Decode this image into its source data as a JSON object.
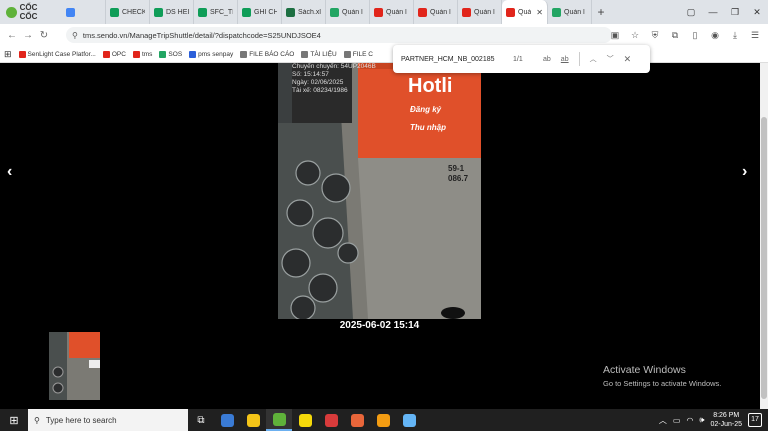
{
  "browser": {
    "brand": "CỐC CỐC",
    "tabs": [
      {
        "label": "",
        "color": "#4285f4"
      },
      {
        "label": "CHECK",
        "color": "#0f9d58"
      },
      {
        "label": "DS HEI",
        "color": "#0f9d58"
      },
      {
        "label": "SFC_TI",
        "color": "#0f9d58"
      },
      {
        "label": "GHI CH",
        "color": "#0f9d58"
      },
      {
        "label": "Sách.xl",
        "color": "#1d6f42"
      },
      {
        "label": "Quản l",
        "color": "#22a563"
      },
      {
        "label": "Quản l",
        "color": "#e1251b"
      },
      {
        "label": "Quản l",
        "color": "#e1251b"
      },
      {
        "label": "Quản l",
        "color": "#e1251b"
      },
      {
        "label": "Quả",
        "color": "#e1251b",
        "active": true
      },
      {
        "label": "Quản l",
        "color": "#22a563"
      }
    ],
    "url": "tms.sendo.vn/ManageTripShuttle/detail/?dispatchcode=S25UNDJSOE4",
    "bookmarks": [
      {
        "label": "SenLight Case Platfor...",
        "color": "#e1251b"
      },
      {
        "label": "OPC",
        "color": "#e1251b"
      },
      {
        "label": "tms",
        "color": "#e1251b"
      },
      {
        "label": "SOS",
        "color": "#22a563"
      },
      {
        "label": "pms senpay",
        "color": "#2b5fd9"
      },
      {
        "label": "FILE BÁO CÁO",
        "color": "#777"
      },
      {
        "label": "TÀI LIỆU",
        "color": "#777"
      },
      {
        "label": "FILE C",
        "color": "#777"
      }
    ]
  },
  "find": {
    "query": "PARTNER_HCM_NB_002185",
    "count": "1/1",
    "match_case": "ab",
    "whole_word": "ab"
  },
  "viewer": {
    "overlay_lines": [
      "Chuyến chuyến: 54UP2046B",
      "Số: 15:14:57",
      "Ngày: 02/06/2025",
      "Tài xế: 08234/1986"
    ],
    "sign_text": "Hotli",
    "sign_line1": "Đăng ký",
    "sign_line2": "Thu nhập",
    "plate": "59-1 086.7",
    "caption": "2025-06-02 15:14",
    "prev": "‹",
    "next": "›"
  },
  "windows": {
    "activate_title": "Activate Windows",
    "activate_sub": "Go to Settings to activate Windows."
  },
  "taskbar": {
    "search_placeholder": "Type here to search",
    "apps": [
      "#3a7bd5",
      "#f5c518",
      "#5fb23a",
      "#f5d90a",
      "#d83b3b",
      "#e8663a",
      "#f39c12",
      "#64b5f6"
    ],
    "time": "8:26 PM",
    "date": "02-Jun-25",
    "notifications": "17"
  }
}
